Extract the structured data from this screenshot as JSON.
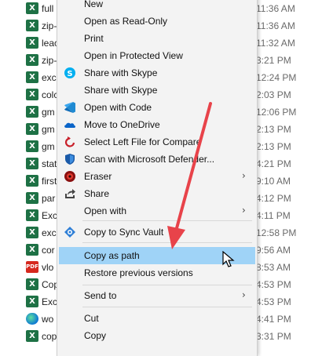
{
  "files": [
    {
      "name": "full",
      "date": "11:36 AM",
      "icon": "excel-icon"
    },
    {
      "name": "zip-",
      "date": "11:36 AM",
      "icon": "excel-icon"
    },
    {
      "name": "leac",
      "date": "11:32 AM",
      "icon": "excel-icon"
    },
    {
      "name": "zip-",
      "date": "3:21 PM",
      "icon": "excel-icon"
    },
    {
      "name": "exc",
      "date": "12:24 PM",
      "icon": "excel-icon"
    },
    {
      "name": "colc",
      "date": "2:03 PM",
      "icon": "excel-icon"
    },
    {
      "name": "gm",
      "date": "12:06 PM",
      "icon": "excel-icon"
    },
    {
      "name": "gm",
      "date": "2:13 PM",
      "icon": "excel-icon"
    },
    {
      "name": "gm",
      "date": "2:13 PM",
      "icon": "excel-icon"
    },
    {
      "name": "stat",
      "date": "4:21 PM",
      "icon": "excel-icon"
    },
    {
      "name": "first",
      "date": "9:10 AM",
      "icon": "excel-icon"
    },
    {
      "name": "par",
      "date": "4:12 PM",
      "icon": "excel-icon"
    },
    {
      "name": "Exc",
      "date": "4:11 PM",
      "icon": "excel-icon"
    },
    {
      "name": "exc",
      "date": "12:58 PM",
      "icon": "excel-icon"
    },
    {
      "name": "cor",
      "date": "9:56 AM",
      "icon": "excel-icon"
    },
    {
      "name": "vlo",
      "date": "8:53 AM",
      "icon": "pdf-icon"
    },
    {
      "name": "Cop",
      "date": "4:53 PM",
      "icon": "excel-icon"
    },
    {
      "name": "Exc",
      "date": "4:53 PM",
      "icon": "excel-icon"
    },
    {
      "name": "wo",
      "date": "4:41 PM",
      "icon": "edge-icon"
    },
    {
      "name": "cop",
      "date": "3:31 PM",
      "icon": "excel-icon"
    }
  ],
  "menu": {
    "items": [
      {
        "label": "New",
        "icon": ""
      },
      {
        "label": "Open as Read-Only",
        "icon": ""
      },
      {
        "label": "Print",
        "icon": ""
      },
      {
        "label": "Open in Protected View",
        "icon": ""
      },
      {
        "label": "Share with Skype",
        "icon": "skype-icon"
      },
      {
        "label": "Share with Skype",
        "icon": ""
      },
      {
        "label": "Open with Code",
        "icon": "vscode-icon"
      },
      {
        "label": "Move to OneDrive",
        "icon": "onedrive-icon"
      },
      {
        "label": "Select Left File for Compare",
        "icon": "compare-icon"
      },
      {
        "label": "Scan with Microsoft Defender...",
        "icon": "defender-icon"
      },
      {
        "label": "Eraser",
        "icon": "eraser-icon",
        "submenu": true
      },
      {
        "label": "Share",
        "icon": "share-icon"
      },
      {
        "label": "Open with",
        "icon": "",
        "submenu": true
      },
      {
        "label": "Copy to Sync Vault",
        "icon": "sync-vault-icon"
      },
      {
        "label": "Copy as path",
        "icon": "",
        "highlighted": true
      },
      {
        "label": "Restore previous versions",
        "icon": ""
      },
      {
        "label": "Send to",
        "icon": "",
        "submenu": true
      },
      {
        "label": "Cut",
        "icon": ""
      },
      {
        "label": "Copy",
        "icon": ""
      }
    ]
  },
  "colors": {
    "highlight": "#9fd3f7",
    "annotation_arrow": "#e8434a",
    "excel": "#1e7145",
    "pdf": "#d6281e"
  }
}
